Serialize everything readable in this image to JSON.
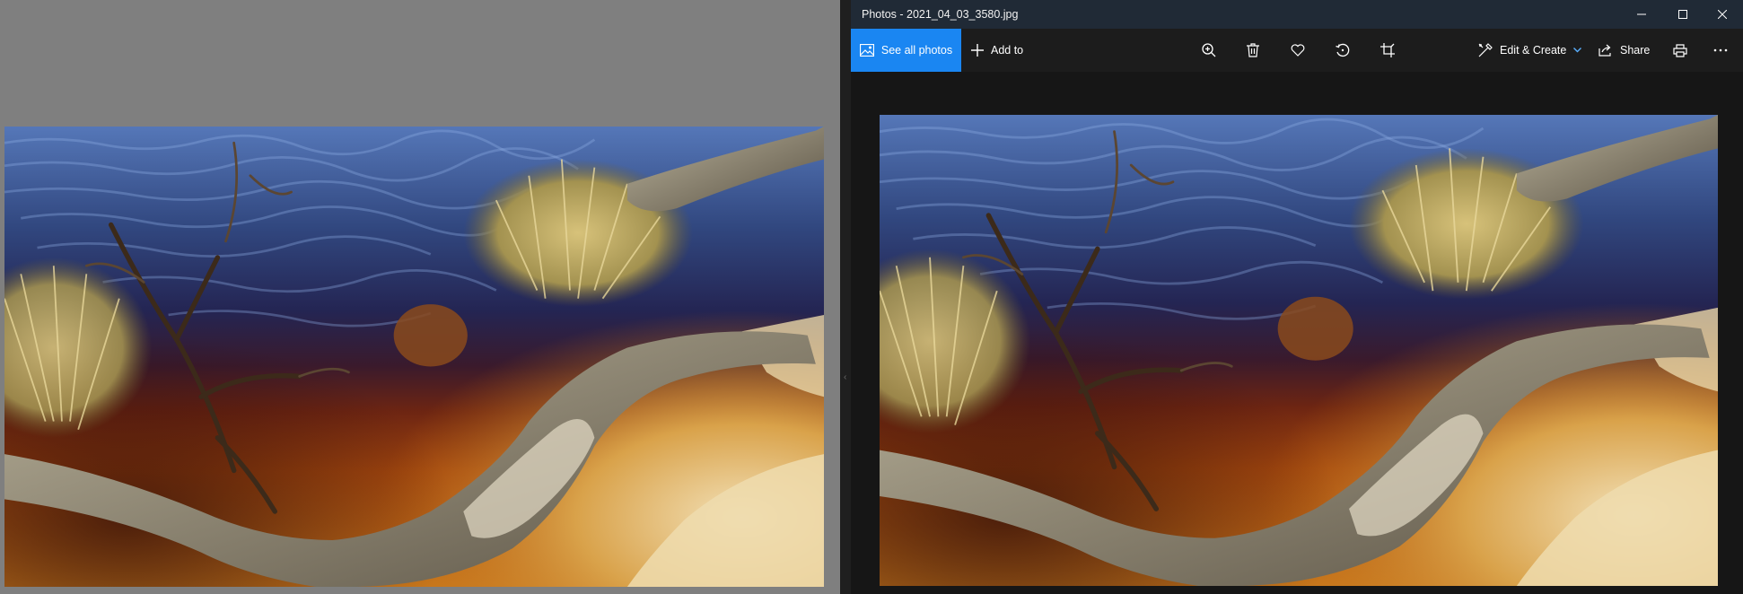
{
  "app": {
    "title": "Photos - 2021_04_03_3580.jpg"
  },
  "window_controls": {
    "minimize_icon": "minimize-icon",
    "maximize_icon": "maximize-icon",
    "close_icon": "close-icon"
  },
  "toolbar": {
    "see_all_photos": "See all photos",
    "add_to": "Add to",
    "edit_create": "Edit & Create",
    "share": "Share",
    "icons": [
      "zoom-in-icon",
      "delete-icon",
      "favorite-icon",
      "rotate-icon",
      "crop-icon",
      "print-icon",
      "more-icon"
    ]
  },
  "colors": {
    "accent": "#1a86f2",
    "titlebar": "#202a36",
    "toolbar": "#1c1c1c",
    "canvas": "#161616",
    "left_background": "#7f7f7f"
  }
}
